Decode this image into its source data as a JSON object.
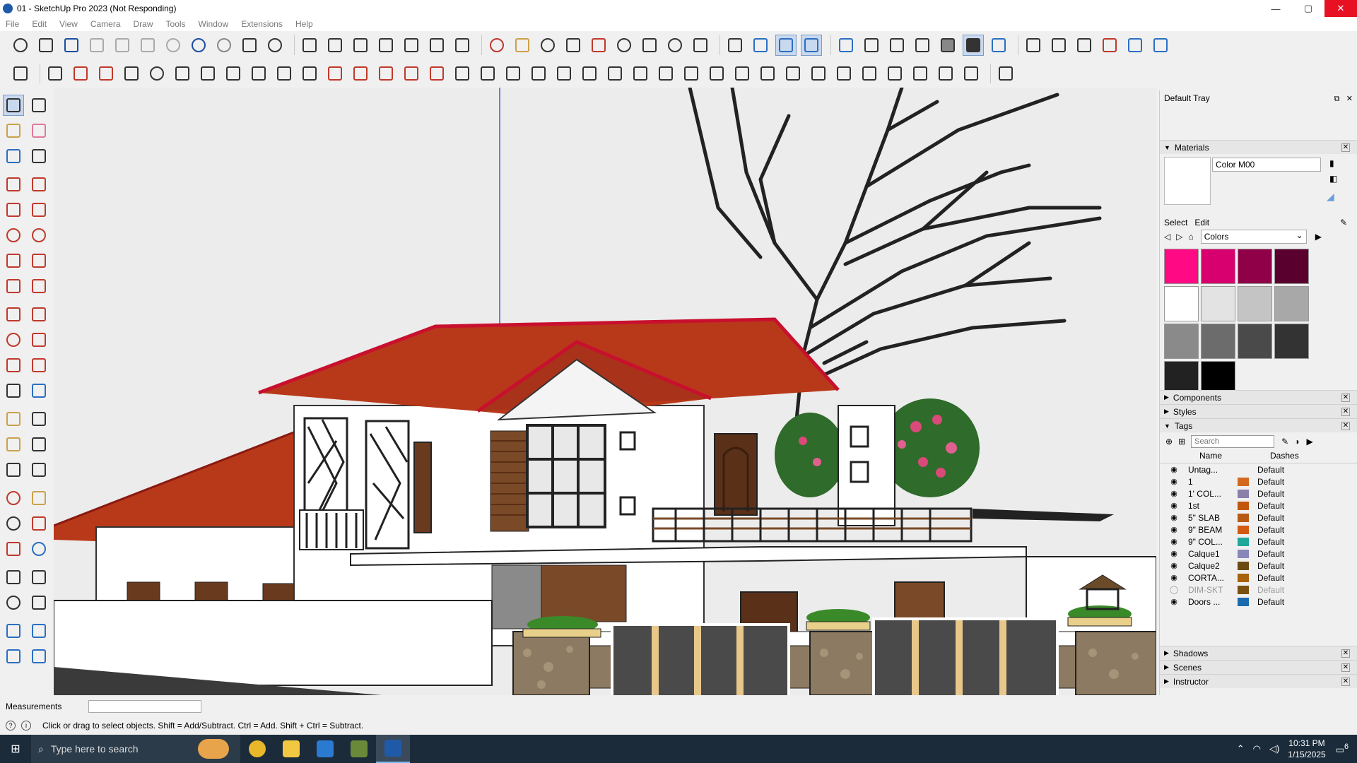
{
  "window": {
    "title": "01 - SketchUp Pro 2023 (Not Responding)",
    "minimize": "—",
    "maximize": "▢",
    "close": "✕"
  },
  "menu": [
    "File",
    "Edit",
    "View",
    "Camera",
    "Draw",
    "Tools",
    "Window",
    "Extensions",
    "Help"
  ],
  "tray": {
    "title": "Default Tray",
    "pin": "⧉",
    "close": "✕",
    "materials": {
      "header": "Materials",
      "name_value": "Color M00",
      "tab_select": "Select",
      "tab_edit": "Edit",
      "library": "Colors",
      "swatches": [
        "#ff0a84",
        "#d7006e",
        "#8f0048",
        "#5a002e",
        "#ffffff",
        "#e3e3e3",
        "#c4c4c4",
        "#a8a8a8",
        "#8a8a8a",
        "#6c6c6c",
        "#4a4a4a",
        "#333333",
        "#222222",
        "#000000"
      ]
    },
    "components_header": "Components",
    "styles_header": "Styles",
    "tags": {
      "header": "Tags",
      "search_placeholder": "Search",
      "col_name": "Name",
      "col_dashes": "Dashes",
      "rows": [
        {
          "name": "Untag...",
          "color": "",
          "dashes": "Default",
          "visible": true
        },
        {
          "name": "1",
          "color": "#d2691e",
          "dashes": "Default",
          "visible": true
        },
        {
          "name": "1' COL...",
          "color": "#8a7fa8",
          "dashes": "Default",
          "visible": true
        },
        {
          "name": "1st",
          "color": "#c2570c",
          "dashes": "Default",
          "visible": true
        },
        {
          "name": "5\" SLAB",
          "color": "#b85a14",
          "dashes": "Default",
          "visible": true
        },
        {
          "name": "9\" BEAM",
          "color": "#d45a10",
          "dashes": "Default",
          "visible": true
        },
        {
          "name": "9\" COL...",
          "color": "#1ea89a",
          "dashes": "Default",
          "visible": true
        },
        {
          "name": "Calque1",
          "color": "#8a88b8",
          "dashes": "Default",
          "visible": true
        },
        {
          "name": "Calque2",
          "color": "#6b4a12",
          "dashes": "Default",
          "visible": true
        },
        {
          "name": "CORTA...",
          "color": "#a8620c",
          "dashes": "Default",
          "visible": true
        },
        {
          "name": "DIM-SKT",
          "color": "#7a5010",
          "dashes": "Default",
          "visible": false
        },
        {
          "name": "Doors ...",
          "color": "#1a6ab0",
          "dashes": "Default",
          "visible": true
        }
      ]
    },
    "shadows_header": "Shadows",
    "scenes_header": "Scenes",
    "instructor_header": "Instructor"
  },
  "measurements": {
    "label": "Measurements",
    "value": ""
  },
  "status": {
    "text": "Click or drag to select objects. Shift = Add/Subtract. Ctrl = Add. Shift + Ctrl = Subtract."
  },
  "taskbar": {
    "search_placeholder": "Type here to search",
    "time": "10:31 PM",
    "date": "1/15/2025",
    "notification_count": "6"
  },
  "colors": {
    "roof": "#b8391a",
    "roof_edge": "#c8102e",
    "wall": "#ffffff",
    "stone": "#8c7a62",
    "wood": "#7a4a28",
    "viewport_bg": "#ececec"
  }
}
